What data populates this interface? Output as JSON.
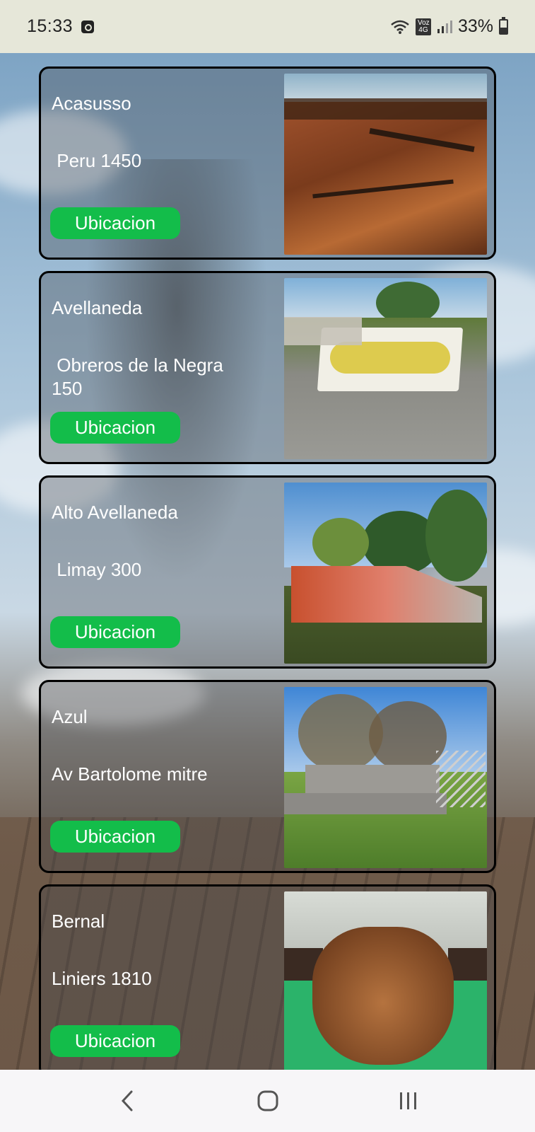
{
  "status_bar": {
    "time": "15:33",
    "network_label": "Voz 4G",
    "battery": "33%"
  },
  "parks": [
    {
      "name": "Acasusso",
      "address": " Peru 1450",
      "button_label": "Ubicacion",
      "photo": "wooden-skate-ramp-photo"
    },
    {
      "name": "Avellaneda",
      "address": " Obreros de la Negra\n150",
      "button_label": "Ubicacion",
      "photo": "graffiti-ramp-photo"
    },
    {
      "name": "Alto Avellaneda",
      "address": " Limay 300",
      "button_label": "Ubicacion",
      "photo": "park-quarter-pipe-photo"
    },
    {
      "name": "Azul",
      "address": "Av Bartolome mitre",
      "button_label": "Ubicacion",
      "photo": "concrete-skatepark-photo"
    },
    {
      "name": "Bernal",
      "address": "Liniers 1810",
      "button_label": "Ubicacion",
      "photo": "indoor-bowl-photo"
    }
  ],
  "nav": {
    "back_icon": "back-chevron-icon",
    "home_icon": "home-rounded-square-icon",
    "recents_icon": "recents-bars-icon"
  },
  "colors": {
    "button_green": "#13bd4a",
    "card_border": "#000000",
    "status_bar_bg": "#e6e7d9",
    "nav_bar_bg": "#f7f6f8"
  }
}
